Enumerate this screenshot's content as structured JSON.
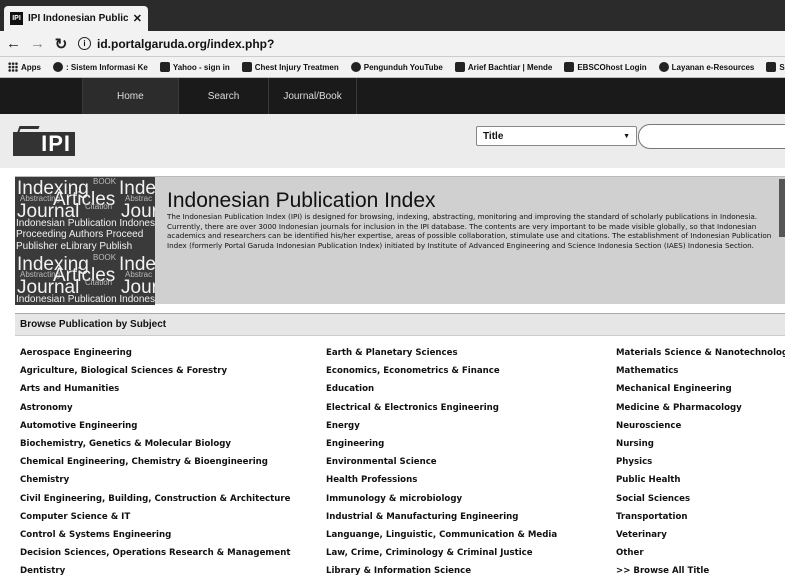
{
  "browser": {
    "tab_title": "IPI Indonesian Publicatio",
    "tab_favicon": "IPI",
    "tab_close": "✕",
    "url": "id.portalgaruda.org/index.php?",
    "bookmarks": [
      {
        "label": "Apps",
        "icon": "apps-grid-icon"
      },
      {
        "label": ": Sistem Informasi Ke",
        "icon": "globe-icon"
      },
      {
        "label": "Yahoo - sign in",
        "icon": "yahoo-icon"
      },
      {
        "label": "Chest Injury Treatmen",
        "icon": "bookmark-icon"
      },
      {
        "label": "Pengunduh YouTube",
        "icon": "downloader-icon"
      },
      {
        "label": "Arief Bachtiar | Mende",
        "icon": "mendeley-icon"
      },
      {
        "label": "EBSCOhost Login",
        "icon": "ebsco-icon"
      },
      {
        "label": "Layanan e-Resources",
        "icon": "resources-icon"
      },
      {
        "label": "SIPENMA",
        "icon": "sipenma-icon"
      }
    ]
  },
  "nav": {
    "items": [
      "Home",
      "Search",
      "Journal/Book"
    ]
  },
  "header": {
    "logo_text": "IPI",
    "search_type": "Title",
    "select_caret": "▼"
  },
  "banner": {
    "wordcloud": [
      {
        "text": "Indexing",
        "cls": "wc-a"
      },
      {
        "text": "BOOK",
        "cls": "wc-b"
      },
      {
        "text": "Index",
        "cls": "wc-a"
      },
      {
        "text": "Abstracting",
        "cls": "wc-b"
      },
      {
        "text": "Articles",
        "cls": "wc-a"
      },
      {
        "text": "Abstrac",
        "cls": "wc-b"
      },
      {
        "text": "Journal",
        "cls": "wc-a"
      },
      {
        "text": "Citation",
        "cls": "wc-b"
      },
      {
        "text": "Journ",
        "cls": "wc-a"
      },
      {
        "text": "Indonesian Publication Indones",
        "cls": "wc-c"
      },
      {
        "text": "Proceeding Authors Proceed",
        "cls": "wc-c"
      },
      {
        "text": "Publisher eLibrary Publish",
        "cls": "wc-c"
      },
      {
        "text": "Indexing",
        "cls": "wc-a"
      },
      {
        "text": "BOOK",
        "cls": "wc-b"
      },
      {
        "text": "Index",
        "cls": "wc-a"
      },
      {
        "text": "Abstracting",
        "cls": "wc-b"
      },
      {
        "text": "Articles",
        "cls": "wc-a"
      },
      {
        "text": "Abstrac",
        "cls": "wc-b"
      },
      {
        "text": "Journal",
        "cls": "wc-a"
      },
      {
        "text": "Citation",
        "cls": "wc-b"
      },
      {
        "text": "Journ",
        "cls": "wc-a"
      },
      {
        "text": "Indonesian Publication Indones",
        "cls": "wc-c"
      }
    ],
    "title": "Indonesian Publication Index",
    "description": "The Indonesian Publication Index (IPI) is designed for browsing, indexing, abstracting, monitoring and improving the standard of scholarly publications in Indonesia. Currently, there are over 3000 Indonesian journals for inclusion in the IPI database. The contents are very important to be made visible globally, so that Indonesian academics and researchers can be identified his/her expertise, areas of possible collaboration, stimulate use and citations. The establishment of Indonesian Publication Index (formerly Portal Garuda Indonesian Publication Index) initiated by Institute of Advanced Engineering and Science Indonesia Section (IAES) Indonesia Section."
  },
  "browse": {
    "heading": "Browse Publication by Subject",
    "col1": [
      "Aerospace Engineering",
      "Agriculture, Biological Sciences & Forestry",
      "Arts and Humanities",
      "Astronomy",
      "Automotive Engineering",
      "Biochemistry, Genetics & Molecular Biology",
      "Chemical Engineering, Chemistry & Bioengineering",
      "Chemistry",
      "Civil Engineering, Building, Construction & Architecture",
      "Computer Science & IT",
      "Control & Systems Engineering",
      "Decision Sciences, Operations Research & Management",
      "Dentistry"
    ],
    "col2": [
      "Earth & Planetary Sciences",
      "Economics, Econometrics & Finance",
      "Education",
      "Electrical & Electronics Engineering",
      "Energy",
      "Engineering",
      "Environmental Science",
      "Health Professions",
      "Immunology & microbiology",
      "Industrial & Manufacturing Engineering",
      "Languange, Linguistic, Communication & Media",
      "Law, Crime, Criminology & Criminal Justice",
      "Library & Information Science"
    ],
    "col3": [
      "Materials Science & Nanotechnology",
      "Mathematics",
      "Mechanical Engineering",
      "Medicine & Pharmacology",
      "Neuroscience",
      "Nursing",
      "Physics",
      "Public Health",
      "Social Sciences",
      "Transportation",
      "Veterinary",
      "Other",
      ">> Browse All Title"
    ]
  }
}
